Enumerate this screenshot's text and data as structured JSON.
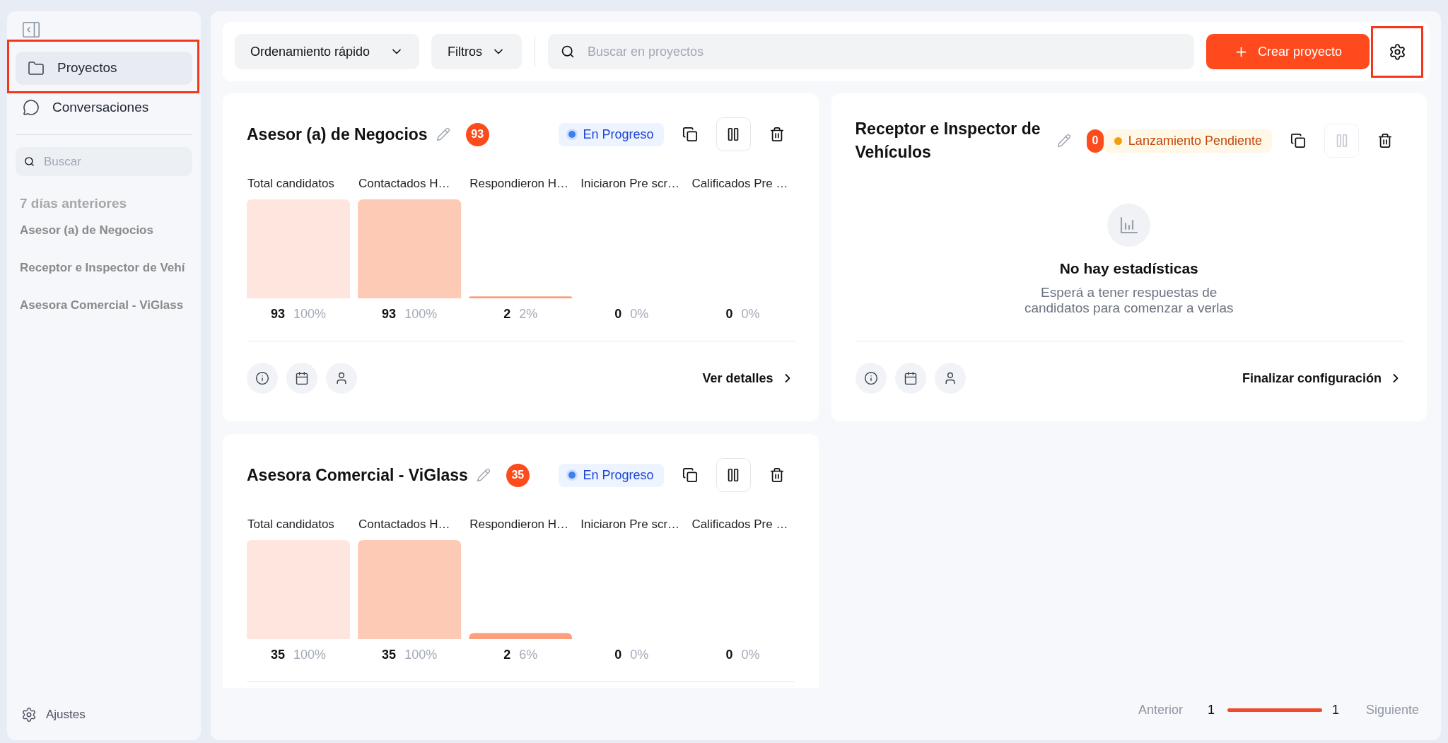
{
  "sidebar": {
    "nav": [
      {
        "label": "Proyectos",
        "kind": "folder",
        "selected": true,
        "highlighted": true
      },
      {
        "label": "Conversaciones",
        "kind": "chat",
        "selected": false,
        "highlighted": false
      }
    ],
    "search": {
      "placeholder": "Buscar"
    },
    "history": {
      "heading": "7 días anteriores",
      "items": [
        "Asesor (a) de Negocios",
        "Receptor e Inspector de Vehí",
        "Asesora Comercial - ViGlass"
      ]
    },
    "settings": {
      "label": "Ajustes"
    }
  },
  "toolbar": {
    "sort": {
      "label": "Ordenamiento rápido"
    },
    "filters": {
      "label": "Filtros"
    },
    "search": {
      "placeholder": "Buscar en proyectos"
    },
    "create_button": {
      "label": "Crear proyecto"
    },
    "settings_button": {
      "highlighted": true
    }
  },
  "projects": [
    {
      "title": "Asesor (a) de Negocios",
      "count": "93",
      "status": {
        "label": "En Progreso",
        "kind": "in_progress"
      },
      "pause_button": {
        "disabled": false
      },
      "chart_data": {
        "type": "bar",
        "categories": [
          "Total candidatos",
          "Contactados H…",
          "Respondieron H…",
          "Iniciaron Pre scr…",
          "Calificados Pre …"
        ],
        "values": [
          100,
          100,
          2,
          0,
          0
        ],
        "ylim": [
          0,
          100
        ],
        "value_labels": [
          "100%",
          "100%",
          "2%",
          "0%",
          "0%"
        ]
      },
      "stage_counts": [
        "93",
        "93",
        "2",
        "0",
        "0"
      ],
      "footer": {
        "link": "Ver detalles"
      }
    },
    {
      "title": "Receptor e Inspector de Vehículos",
      "count": "0",
      "status": {
        "label": "Lanzamiento Pendiente",
        "kind": "pending"
      },
      "pause_button": {
        "disabled": true
      },
      "empty_state": {
        "title": "No hay estadísticas",
        "message": "Esperá a tener respuestas de candidatos para comenzar a verlas"
      },
      "footer": {
        "link": "Finalizar configuración"
      }
    },
    {
      "title": "Asesora Comercial - ViGlass",
      "count": "35",
      "status": {
        "label": "En Progreso",
        "kind": "in_progress"
      },
      "pause_button": {
        "disabled": false
      },
      "chart_data": {
        "type": "bar",
        "categories": [
          "Total candidatos",
          "Contactados H…",
          "Respondieron H…",
          "Iniciaron Pre scr…",
          "Calificados Pre …"
        ],
        "values": [
          100,
          100,
          6,
          0,
          0
        ],
        "ylim": [
          0,
          100
        ],
        "value_labels": [
          "100%",
          "100%",
          "6%",
          "0%",
          "0%"
        ]
      },
      "stage_counts": [
        "35",
        "35",
        "2",
        "0",
        "0"
      ]
    }
  ],
  "pagination": {
    "previous": {
      "label": "Anterior",
      "disabled": true
    },
    "current_page": "1",
    "level": 1,
    "total_pages": "1",
    "next": {
      "label": "Siguiente",
      "disabled": true
    }
  }
}
